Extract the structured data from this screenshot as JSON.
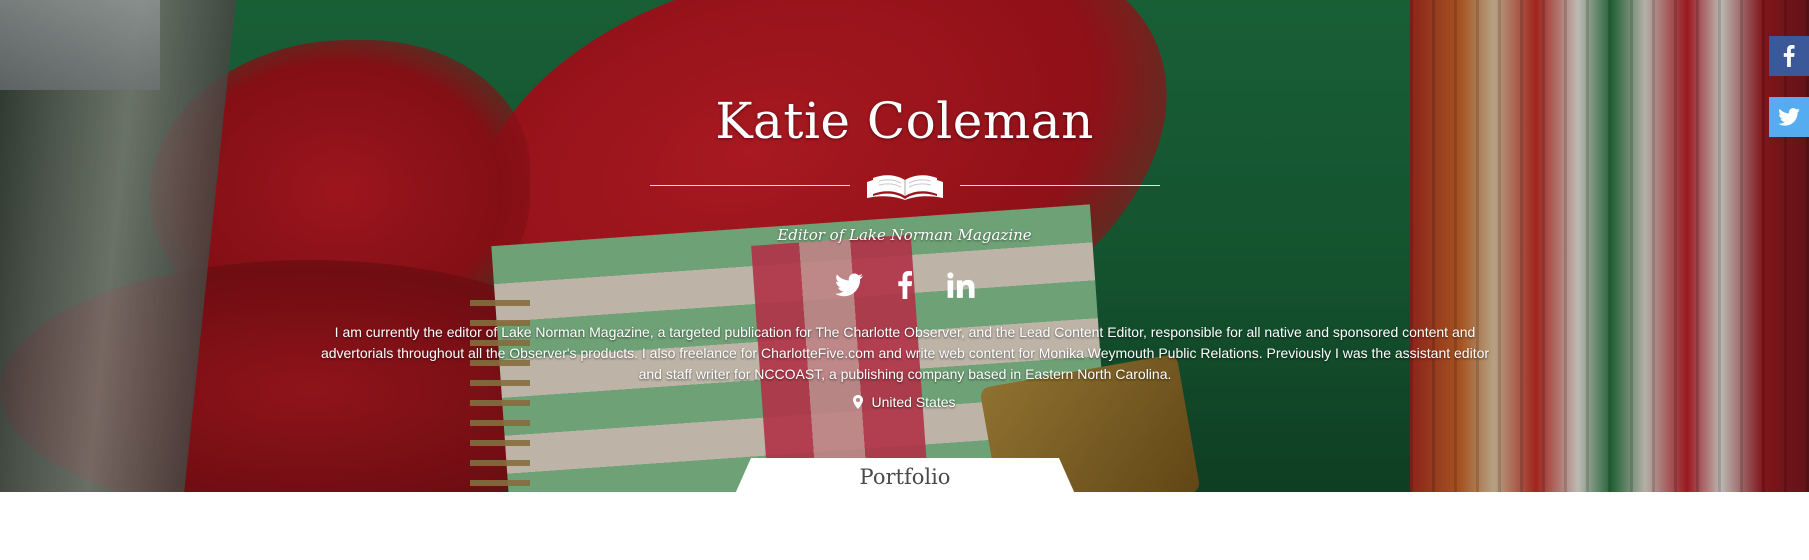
{
  "profile": {
    "name": "Katie Coleman",
    "headline": "Editor of Lake Norman Magazine",
    "bio": "I am currently the editor of Lake Norman Magazine, a targeted publication for The Charlotte Observer, and the Lead Content Editor, responsible for all native and sponsored content and advertorials throughout all the Observer's products. I also freelance for CharlotteFive.com and write web content for Monika Weymouth Public Relations. Previously I was the assistant editor and staff writer for NCCOAST, a publishing company based in Eastern North Carolina.",
    "location": "United States"
  },
  "social_links": [
    {
      "icon": "twitter-icon"
    },
    {
      "icon": "facebook-icon"
    },
    {
      "icon": "linkedin-icon"
    }
  ],
  "tabs": {
    "active_label": "Portfolio"
  },
  "share_buttons": [
    {
      "icon": "facebook-icon",
      "color": "#3b5998"
    },
    {
      "icon": "twitter-icon",
      "color": "#55acee"
    }
  ],
  "colors": {
    "text_on_hero": "#ffffff",
    "tab_text": "#4a4a4a",
    "page_background": "#ffffff"
  }
}
